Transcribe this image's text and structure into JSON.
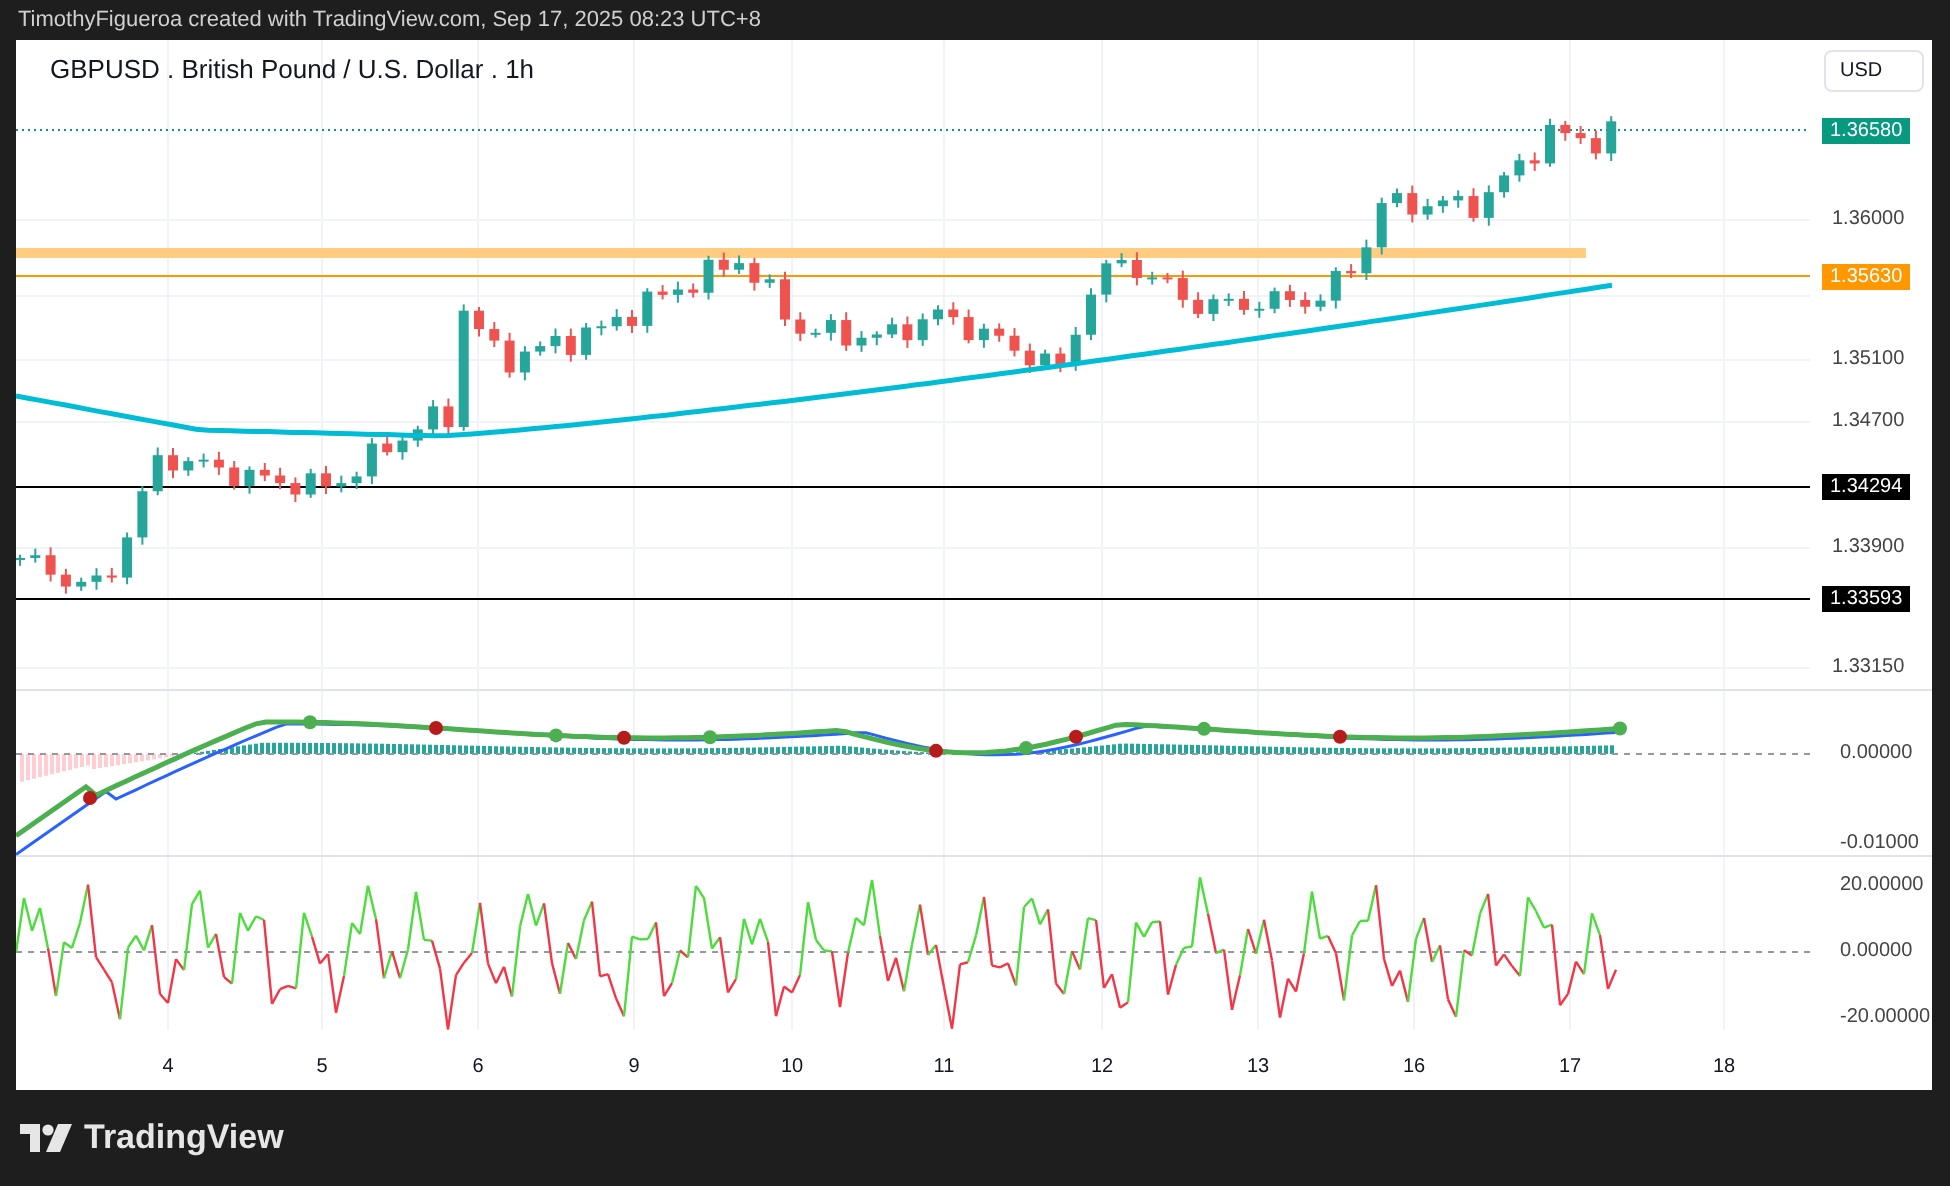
{
  "header": {
    "text": "TimothyFigueroa created with TradingView.com, Sep 17, 2025 08:23 UTC+8"
  },
  "chart": {
    "title": "GBPUSD . British Pound / U.S. Dollar . 1h",
    "currency": "USD",
    "price_axis": [
      "1.36000",
      "1.35100",
      "1.34700",
      "1.33900",
      "1.33150"
    ],
    "price_markers": [
      {
        "label": "1.36580",
        "color": "#089981"
      },
      {
        "label": "1.35630",
        "color": "#ff9800"
      },
      {
        "label": "1.34294",
        "color": "#000000"
      },
      {
        "label": "1.33593",
        "color": "#000000"
      }
    ],
    "macd_axis": [
      "0.00000",
      "-0.01000"
    ],
    "oscillator_axis": [
      "20.00000",
      "0.00000",
      "-20.00000"
    ],
    "time_axis": [
      "4",
      "5",
      "6",
      "9",
      "10",
      "11",
      "12",
      "13",
      "16",
      "17",
      "18"
    ]
  },
  "footer": {
    "logo_text": "TradingView"
  }
}
